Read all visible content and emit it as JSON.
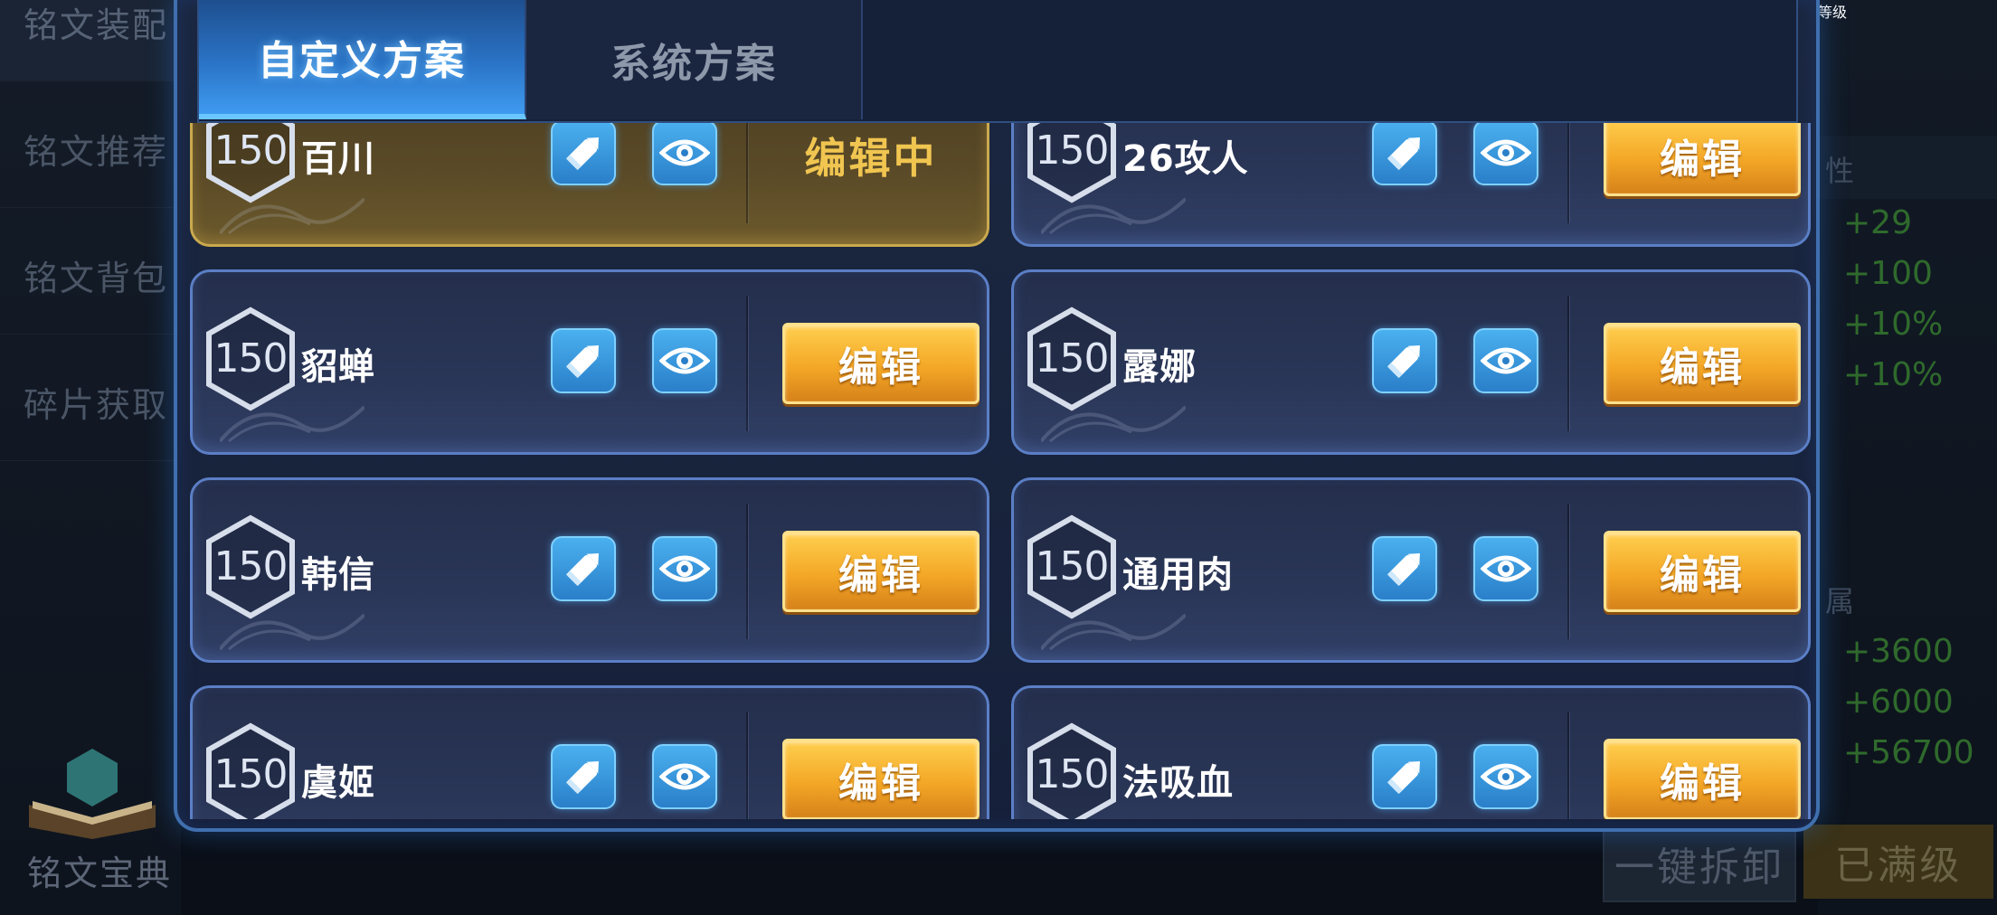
{
  "background": {
    "left_nav": [
      "铭文装配",
      "铭文推荐",
      "铭文背包",
      "碎片获取"
    ],
    "book_label": "铭文宝典",
    "right_panel": {
      "level_title": "等级",
      "attr_header_1": "性",
      "stats_1": [
        "+29",
        "+100",
        "+10%",
        "+10%"
      ],
      "attr_header_2": "属",
      "stats_2": [
        "+3600",
        "+6000",
        "+56700"
      ]
    },
    "buttons": {
      "disassemble": "一键拆卸",
      "maxed": "已满级"
    }
  },
  "modal": {
    "tabs": [
      {
        "label": "自定义方案",
        "active": true
      },
      {
        "label": "系统方案",
        "active": false
      }
    ],
    "schemes": [
      {
        "level": "150",
        "name": "百川",
        "status": "编辑中",
        "active": true
      },
      {
        "level": "150",
        "name": "26攻人",
        "status": "编辑",
        "active": false
      },
      {
        "level": "150",
        "name": "貂蝉",
        "status": "编辑",
        "active": false
      },
      {
        "level": "150",
        "name": "露娜",
        "status": "编辑",
        "active": false
      },
      {
        "level": "150",
        "name": "韩信",
        "status": "编辑",
        "active": false
      },
      {
        "level": "150",
        "name": "通用肉",
        "status": "编辑",
        "active": false
      },
      {
        "level": "150",
        "name": "虞姬",
        "status": "编辑",
        "active": false
      },
      {
        "level": "150",
        "name": "法吸血",
        "status": "编辑",
        "active": false
      }
    ]
  },
  "colors": {
    "accent_blue": "#3f9bf0",
    "edit_button_gold": "#f4a726",
    "active_card_gold": "#c9a94e",
    "stat_green": "#2f6a2c"
  },
  "icons": {
    "rename": "pencil-icon",
    "view": "eye-icon",
    "level": "hexagon-icon",
    "book": "book-icon"
  }
}
